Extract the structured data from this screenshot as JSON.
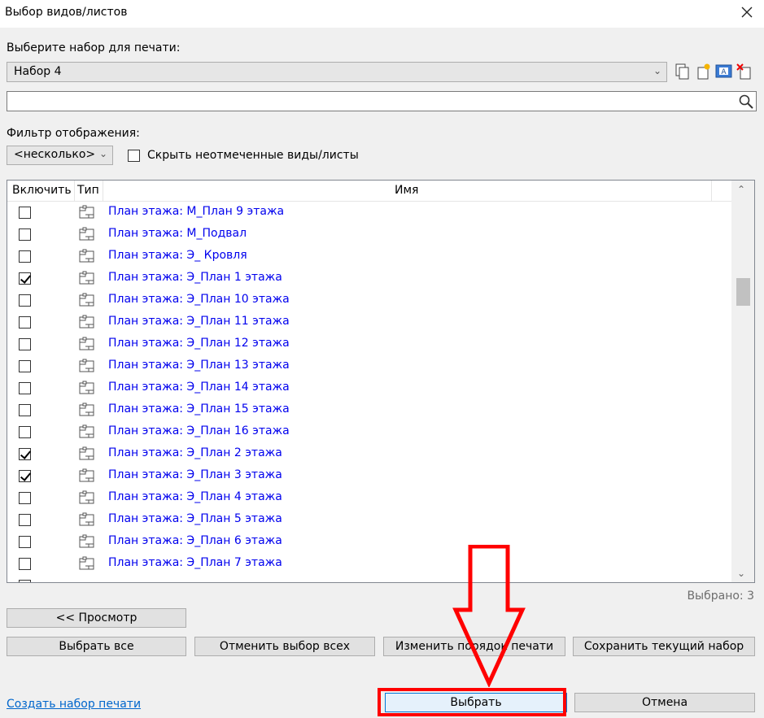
{
  "window": {
    "title": "Выбор видов/листов"
  },
  "print_set": {
    "label": "Выберите набор для печати:",
    "value": "Набор 4",
    "tools": [
      "copy-set-icon",
      "new-set-icon",
      "rename-set-icon",
      "delete-set-icon"
    ]
  },
  "search": {
    "value": "",
    "placeholder": ""
  },
  "filter": {
    "label": "Фильтр отображения:",
    "value": "<несколько>",
    "hide_unchecked_label": "Скрыть неотмеченные виды/листы",
    "hide_unchecked": false
  },
  "table": {
    "headers": {
      "include": "Включить",
      "type": "Тип",
      "name": "Имя"
    },
    "rows": [
      {
        "checked": false,
        "name": "План этажа: М_План 9 этажа"
      },
      {
        "checked": false,
        "name": "План этажа: М_Подвал"
      },
      {
        "checked": false,
        "name": "План этажа: Э_ Кровля"
      },
      {
        "checked": true,
        "name": "План этажа: Э_План 1 этажа"
      },
      {
        "checked": false,
        "name": "План этажа: Э_План 10 этажа"
      },
      {
        "checked": false,
        "name": "План этажа: Э_План 11 этажа"
      },
      {
        "checked": false,
        "name": "План этажа: Э_План 12 этажа"
      },
      {
        "checked": false,
        "name": "План этажа: Э_План 13 этажа"
      },
      {
        "checked": false,
        "name": "План этажа: Э_План 14 этажа"
      },
      {
        "checked": false,
        "name": "План этажа: Э_План 15 этажа"
      },
      {
        "checked": false,
        "name": "План этажа: Э_План 16 этажа"
      },
      {
        "checked": true,
        "name": "План этажа: Э_План 2 этажа"
      },
      {
        "checked": true,
        "name": "План этажа: Э_План 3 этажа"
      },
      {
        "checked": false,
        "name": "План этажа: Э_План 4 этажа"
      },
      {
        "checked": false,
        "name": "План этажа: Э_План 5 этажа"
      },
      {
        "checked": false,
        "name": "План этажа: Э_План 6 этажа"
      },
      {
        "checked": false,
        "name": "План этажа: Э_План 7 этажа"
      }
    ]
  },
  "selected_count": "Выбрано: 3",
  "buttons": {
    "preview": "<< Просмотр",
    "select_all": "Выбрать все",
    "deselect_all": "Отменить выбор всех",
    "change_order": "Изменить порядок печати",
    "save_set": "Сохранить текущий набор",
    "create_set_link": "Создать набор печати",
    "ok": "Выбрать",
    "cancel": "Отмена"
  },
  "annotation": {
    "color": "#ff0000"
  }
}
